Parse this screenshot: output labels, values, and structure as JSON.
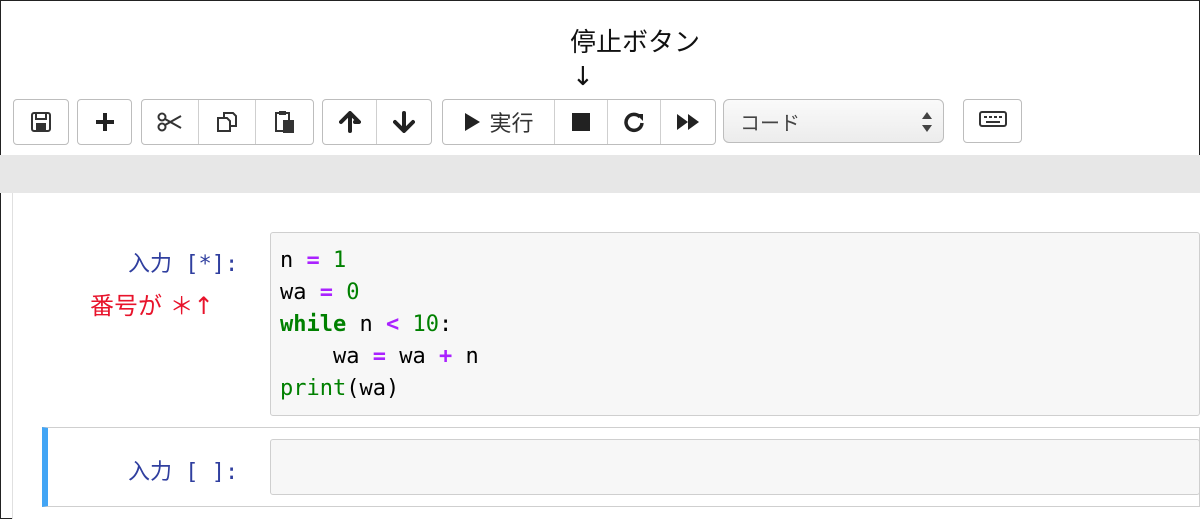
{
  "annotation": {
    "title": "停止ボタン",
    "arrow": "↓",
    "cell_note": "番号が ＊↑"
  },
  "toolbar": {
    "run_label": "実行",
    "cell_type": "コード",
    "buttons": [
      "save-icon",
      "plus-icon",
      "scissors-icon",
      "copy-icon",
      "paste-icon",
      "arrow-up-icon",
      "arrow-down-icon",
      "run-icon",
      "stop-icon",
      "restart-icon",
      "fast-forward-icon",
      "keyboard-icon"
    ]
  },
  "cells": [
    {
      "prompt": "入力 [*]:",
      "code_lines": [
        "n = 1",
        "wa = 0",
        "while n < 10:",
        "    wa = wa + n",
        "print(wa)"
      ]
    },
    {
      "prompt": "入力 [ ]:",
      "code_lines": []
    }
  ],
  "colors": {
    "prompt": "#303f9f",
    "operator": "#aa22ff",
    "keyword": "#008000",
    "annotation_red": "#e8132b",
    "selected_cell_bar": "#42a5f5"
  }
}
